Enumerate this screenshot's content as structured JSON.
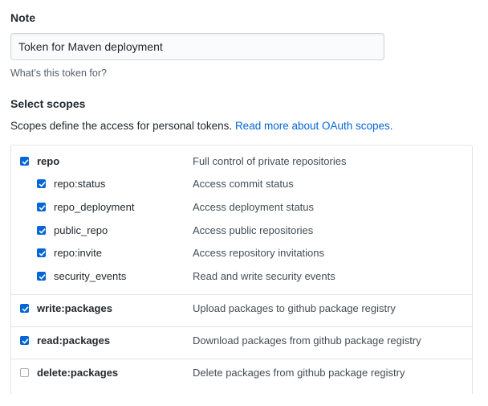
{
  "note": {
    "heading": "Note",
    "value": "Token for Maven deployment",
    "help": "What’s this token for?"
  },
  "scopes": {
    "heading": "Select scopes",
    "description": "Scopes define the access for personal tokens.",
    "link_text": "Read more about OAuth scopes.",
    "items": [
      {
        "name": "repo",
        "desc": "Full control of private repositories",
        "checked": true
      },
      {
        "name": "repo:status",
        "desc": "Access commit status",
        "checked": true
      },
      {
        "name": "repo_deployment",
        "desc": "Access deployment status",
        "checked": true
      },
      {
        "name": "public_repo",
        "desc": "Access public repositories",
        "checked": true
      },
      {
        "name": "repo:invite",
        "desc": "Access repository invitations",
        "checked": true
      },
      {
        "name": "security_events",
        "desc": "Read and write security events",
        "checked": true
      },
      {
        "name": "write:packages",
        "desc": "Upload packages to github package registry",
        "checked": true
      },
      {
        "name": "read:packages",
        "desc": "Download packages from github package registry",
        "checked": true
      },
      {
        "name": "delete:packages",
        "desc": "Delete packages from github package registry",
        "checked": false
      }
    ]
  },
  "colors": {
    "accent": "#0366d6",
    "border": "#e1e4e8"
  }
}
